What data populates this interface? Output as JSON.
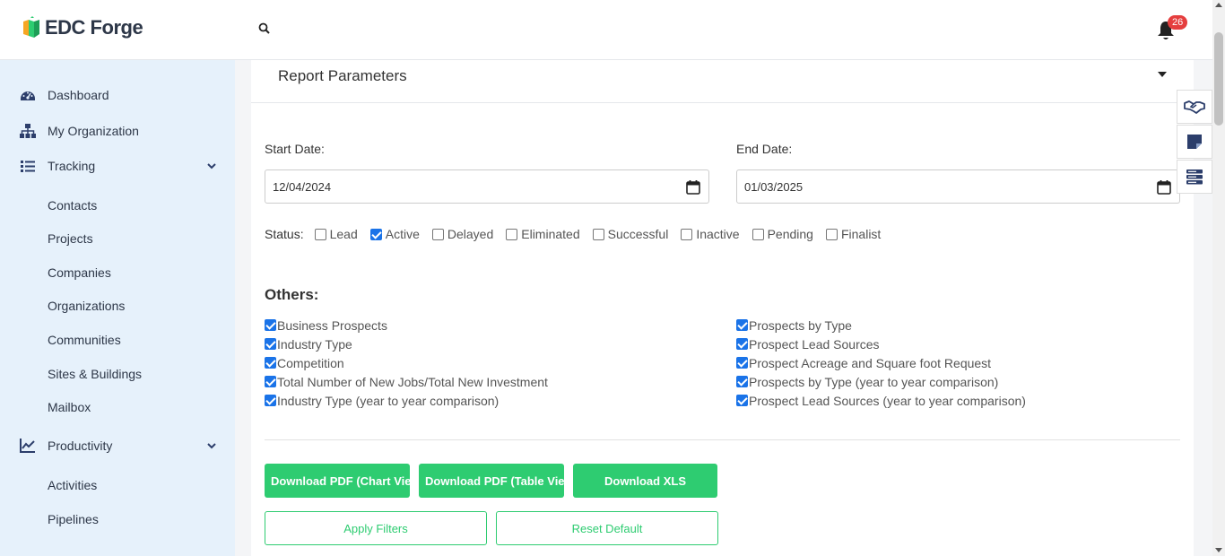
{
  "brand": {
    "name": "EDC Forge"
  },
  "header": {
    "notification_count": "26"
  },
  "sidebar": {
    "items": [
      {
        "label": "Dashboard",
        "icon": "dashboard-icon"
      },
      {
        "label": "My Organization",
        "icon": "sitemap-icon"
      },
      {
        "label": "Tracking",
        "icon": "list-icon",
        "expanded": true
      },
      {
        "label": "Productivity",
        "icon": "chart-line-icon",
        "expanded": true
      }
    ],
    "tracking_sub": [
      "Contacts",
      "Projects",
      "Companies",
      "Organizations",
      "Communities",
      "Sites & Buildings",
      "Mailbox"
    ],
    "productivity_sub": [
      "Activities",
      "Pipelines"
    ]
  },
  "report": {
    "title": "Report Parameters",
    "start_label": "Start Date:",
    "start_value": "12/04/2024",
    "end_label": "End Date:",
    "end_value": "01/03/2025",
    "status_label": "Status:",
    "statuses": [
      {
        "label": "Lead",
        "checked": false
      },
      {
        "label": "Active",
        "checked": true
      },
      {
        "label": "Delayed",
        "checked": false
      },
      {
        "label": "Eliminated",
        "checked": false
      },
      {
        "label": "Successful",
        "checked": false
      },
      {
        "label": "Inactive",
        "checked": false
      },
      {
        "label": "Pending",
        "checked": false
      },
      {
        "label": "Finalist",
        "checked": false
      }
    ],
    "others_title": "Others:",
    "others_left": [
      "Business Prospects",
      "Industry Type",
      "Competition",
      "Total Number of New Jobs/Total New Investment",
      "Industry Type (year to year comparison)"
    ],
    "others_right": [
      "Prospects by Type",
      "Prospect Lead Sources",
      "Prospect Acreage and Square foot Request",
      "Prospects by Type (year to year comparison)",
      "Prospect Lead Sources (year to year comparison)"
    ]
  },
  "buttons": {
    "pdf_chart": "Download PDF (Chart View)",
    "pdf_table": "Download PDF (Table View)",
    "xls": "Download XLS",
    "apply": "Apply Filters",
    "reset": "Reset Default"
  },
  "colors": {
    "accent": "#2ecc71",
    "sidebar_bg": "#e6f1fb",
    "badge": "#e53e3e"
  }
}
